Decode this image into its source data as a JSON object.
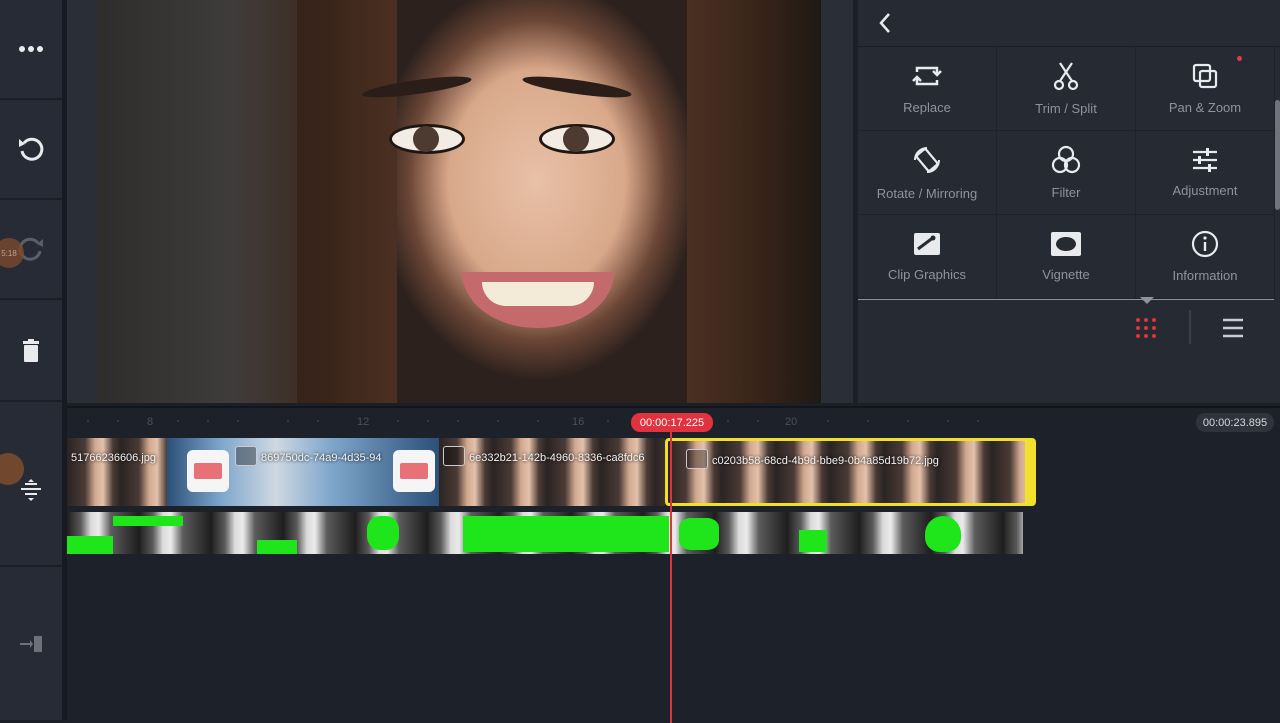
{
  "toolbar_left": {
    "items": [
      {
        "name": "more-icon"
      },
      {
        "name": "undo-icon"
      },
      {
        "name": "redo-icon",
        "badge": "5:18"
      },
      {
        "name": "delete-icon"
      }
    ],
    "timeline_tools": [
      {
        "name": "split-layers-icon"
      },
      {
        "name": "exit-icon"
      }
    ]
  },
  "panel": {
    "items": [
      {
        "label": "Replace",
        "icon": "replace-icon"
      },
      {
        "label": "Trim / Split",
        "icon": "scissors-icon"
      },
      {
        "label": "Pan & Zoom",
        "icon": "pan-zoom-icon"
      },
      {
        "label": "Rotate / Mirroring",
        "icon": "rotate-icon"
      },
      {
        "label": "Filter",
        "icon": "filter-icon"
      },
      {
        "label": "Adjustment",
        "icon": "sliders-icon"
      },
      {
        "label": "Clip Graphics",
        "icon": "clip-graphics-icon"
      },
      {
        "label": "Vignette",
        "icon": "vignette-icon"
      },
      {
        "label": "Information",
        "icon": "info-icon"
      }
    ]
  },
  "timeline": {
    "ruler_labels": [
      "8",
      "12",
      "16",
      "20"
    ],
    "current_time": "00:00:17.225",
    "total_time": "00:00:23.895",
    "clips": [
      {
        "name": "51766236606.jpg"
      },
      {
        "name": "869750dc-74a9-4d35-94"
      },
      {
        "name": "6e332b21-142b-4960-8336-ca8fdc6"
      },
      {
        "name": "c0203b58-68cd-4b9d-bbe9-0b4a85d19b72.jpg"
      }
    ]
  },
  "colors": {
    "accent": "#e0323f",
    "selection": "#f2e12c",
    "chroma": "#1ee61a"
  }
}
